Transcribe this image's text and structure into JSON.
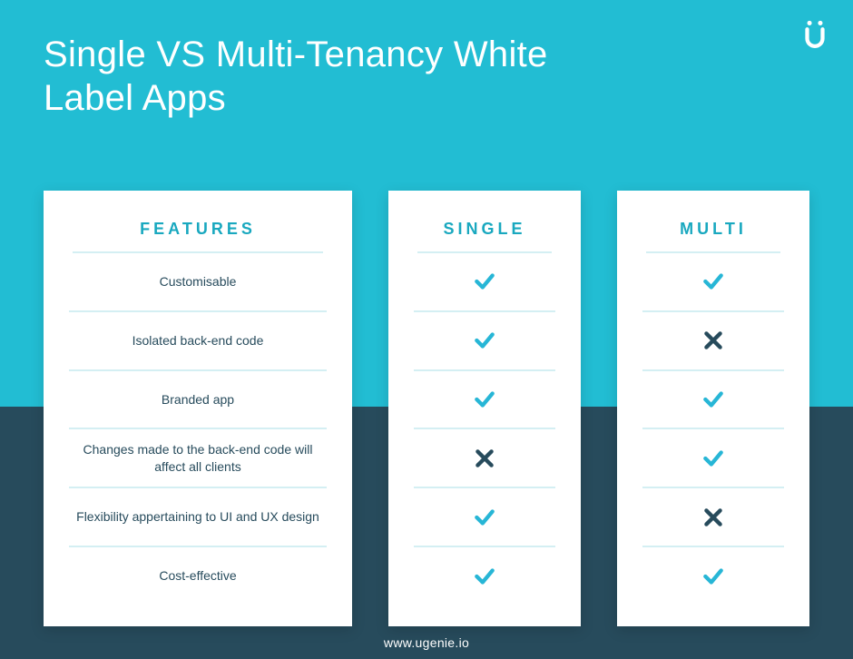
{
  "title": "Single VS Multi-Tenancy White Label Apps",
  "footer": "www.ugenie.io",
  "logo": "ugenie-logo",
  "columns": {
    "features": "FEATURES",
    "single": "SINGLE",
    "multi": "MULTI"
  },
  "features": [
    "Customisable",
    "Isolated back-end code",
    "Branded app",
    "Changes made to the back-end code will affect all clients",
    "Flexibility appertaining to UI and UX design",
    "Cost-effective"
  ],
  "single": [
    "check",
    "check",
    "check",
    "cross",
    "check",
    "check"
  ],
  "multi": [
    "check",
    "cross",
    "check",
    "check",
    "cross",
    "check"
  ],
  "colors": {
    "check": "#27b6d6",
    "cross": "#274b5c"
  },
  "chart_data": {
    "type": "table",
    "title": "Single VS Multi-Tenancy White Label Apps",
    "columns": [
      "Feature",
      "Single",
      "Multi"
    ],
    "rows": [
      [
        "Customisable",
        true,
        true
      ],
      [
        "Isolated back-end code",
        true,
        false
      ],
      [
        "Branded app",
        true,
        true
      ],
      [
        "Changes made to the back-end code will affect all clients",
        false,
        true
      ],
      [
        "Flexibility appertaining to UI and UX design",
        true,
        false
      ],
      [
        "Cost-effective",
        true,
        true
      ]
    ]
  }
}
